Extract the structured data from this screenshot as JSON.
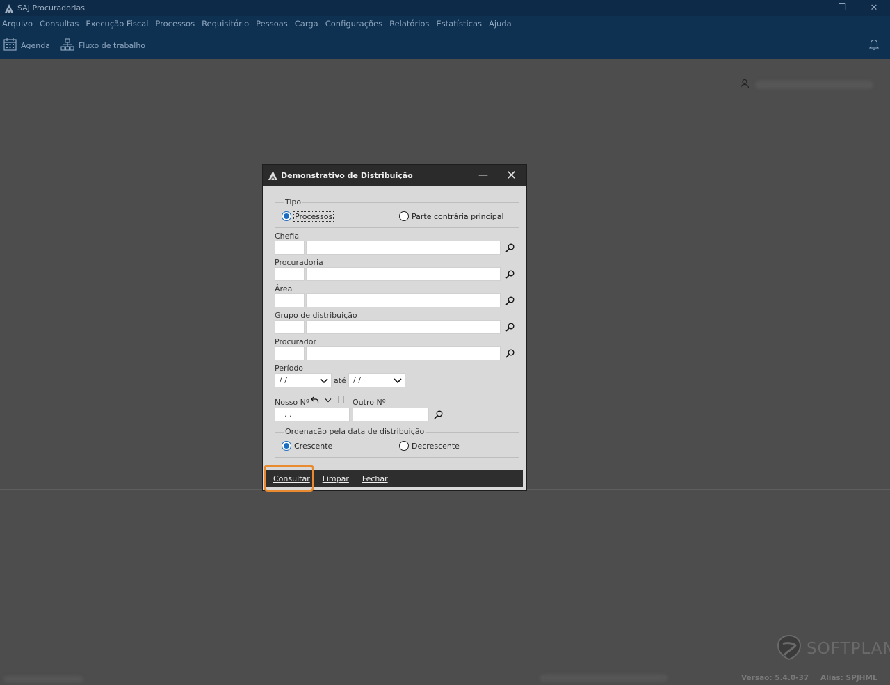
{
  "app": {
    "title": "SAJ Procuradorias",
    "window_controls": {
      "minimize": "—",
      "restore": "❐",
      "close": "✕"
    }
  },
  "menubar": {
    "items": [
      "Arquivo",
      "Consultas",
      "Execução Fiscal",
      "Processos",
      "Requisitório",
      "Pessoas",
      "Carga",
      "Configurações",
      "Relatórios",
      "Estatísticas",
      "Ajuda"
    ]
  },
  "toolbar": {
    "agenda_label": "Agenda",
    "fluxo_label": "Fluxo de trabalho"
  },
  "status": {
    "version": "Versão: 5.4.0-37",
    "alias": "Alias: SPJHML"
  },
  "brand": {
    "name": "SOFTPLAN"
  },
  "dialog": {
    "title": "Demonstrativo de Distribuição",
    "tipo": {
      "legend": "Tipo",
      "option_processos": "Processos",
      "option_parte": "Parte contrária principal",
      "selected": "Processos"
    },
    "fields": {
      "chefia": "Chefia",
      "procuradoria": "Procuradoria",
      "area": "Área",
      "grupo": "Grupo de distribuição",
      "procurador": "Procurador"
    },
    "periodo": {
      "label": "Período",
      "from_value": "/ /",
      "to_label": "até",
      "to_value": "/ /"
    },
    "nosso_numero": {
      "label": "Nosso Nº",
      "value": ". ."
    },
    "outro_numero": {
      "label": "Outro Nº",
      "value": ""
    },
    "ordenacao": {
      "legend": "Ordenação pela data de distribuição",
      "option_crescente": "Crescente",
      "option_decrescente": "Decrescente",
      "selected": "Crescente"
    },
    "buttons": {
      "consultar": "Consultar",
      "limpar": "Limpar",
      "fechar": "Fechar"
    }
  }
}
